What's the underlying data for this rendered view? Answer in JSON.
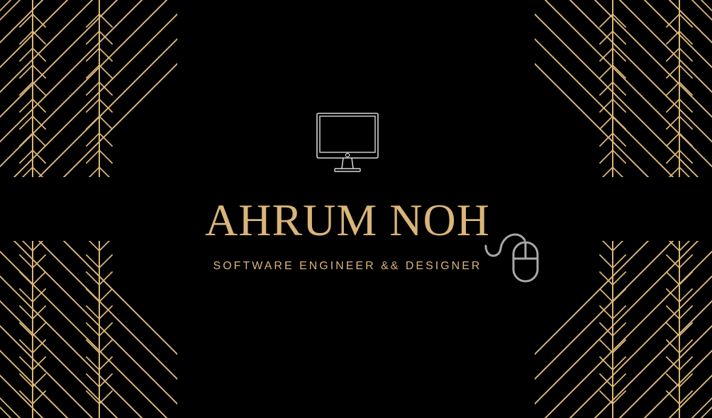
{
  "card": {
    "name": "AHRUM NOH",
    "role": "SOFTWARE ENGINEER && DESIGNER"
  },
  "icons": {
    "top": "desktop-monitor-icon",
    "side": "computer-mouse-icon"
  },
  "colors": {
    "background": "#000000",
    "gold": "#d9b57a",
    "icon_outline": "#d8d8d8",
    "mouse_outline": "#a8a8a8"
  }
}
